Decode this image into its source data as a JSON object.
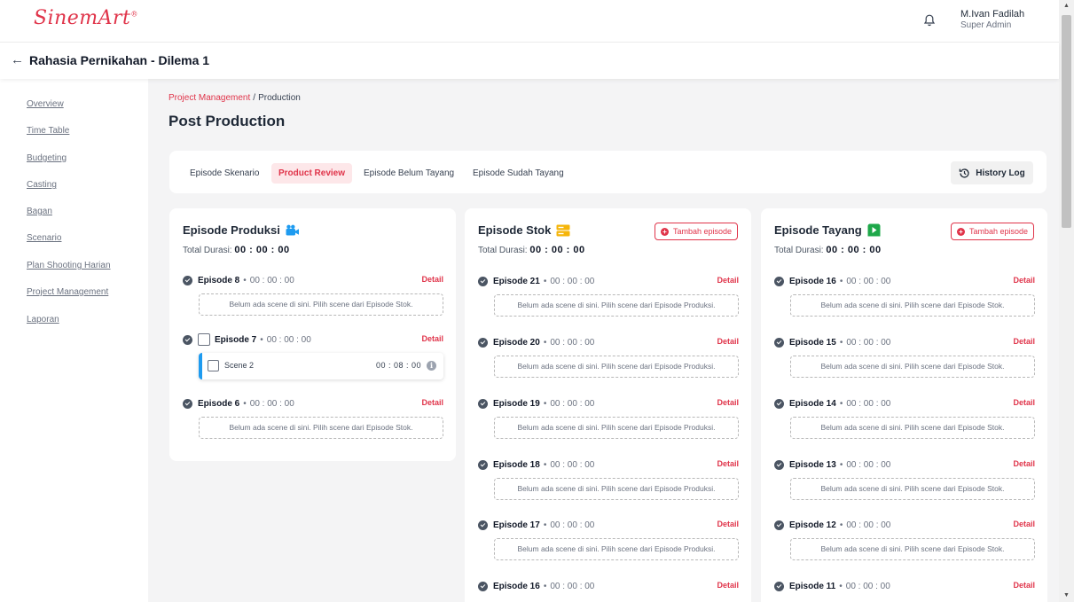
{
  "app": {
    "logo": "SinemArt",
    "logo_mark": "®"
  },
  "user": {
    "name": "M.Ivan Fadilah",
    "role": "Super Admin"
  },
  "project": {
    "back_arrow": "←",
    "title": "Rahasia Pernikahan - Dilema 1"
  },
  "sidebar": {
    "items": [
      {
        "label": "Overview"
      },
      {
        "label": "Time Table"
      },
      {
        "label": "Budgeting"
      },
      {
        "label": "Casting"
      },
      {
        "label": "Bagan"
      },
      {
        "label": "Scenario"
      },
      {
        "label": "Plan Shooting Harian"
      },
      {
        "label": "Project Management"
      },
      {
        "label": "Laporan"
      }
    ]
  },
  "breadcrumb": {
    "parent": "Project Management",
    "separator": "/",
    "current": "Production"
  },
  "page_title": "Post Production",
  "tabs": [
    {
      "label": "Episode Skenario",
      "active": false
    },
    {
      "label": "Product Review",
      "active": true
    },
    {
      "label": "Episode Belum Tayang",
      "active": false
    },
    {
      "label": "Episode Sudah Tayang",
      "active": false
    }
  ],
  "history_log": {
    "label": "History Log"
  },
  "colors": {
    "accent": "#e0344a",
    "scene_bar": "#1e9bf0",
    "stok_icon": "#f5b50a",
    "tayang_icon": "#1ea84a",
    "produksi_icon": "#1e9bf0"
  },
  "columns": {
    "produksi": {
      "title": "Episode Produksi",
      "icon": "camera-icon",
      "total_label": "Total Durasi:",
      "total_value": "00 : 00 : 00",
      "episodes": [
        {
          "name": "Episode 8",
          "time": "00 : 00 : 00",
          "detail": "Detail",
          "empty": "Belum ada scene di sini. Pilih scene dari Episode Stok."
        },
        {
          "name": "Episode 7",
          "time": "00 : 00 : 00",
          "detail": "Detail",
          "scene": {
            "label": "Scene 2",
            "time": "00 : 08 : 00"
          }
        },
        {
          "name": "Episode 6",
          "time": "00 : 00 : 00",
          "detail": "Detail",
          "empty": "Belum ada scene di sini. Pilih scene dari Episode Stok."
        }
      ]
    },
    "stok": {
      "title": "Episode Stok",
      "icon": "server-icon",
      "add_label": "Tambah episode",
      "total_label": "Total Durasi:",
      "total_value": "00 : 00 : 00",
      "episodes": [
        {
          "name": "Episode 21",
          "time": "00 : 00 : 00",
          "detail": "Detail",
          "empty": "Belum ada scene di sini. Pilih scene dari Episode Produksi."
        },
        {
          "name": "Episode 20",
          "time": "00 : 00 : 00",
          "detail": "Detail",
          "empty": "Belum ada scene di sini. Pilih scene dari Episode Produksi."
        },
        {
          "name": "Episode 19",
          "time": "00 : 00 : 00",
          "detail": "Detail",
          "empty": "Belum ada scene di sini. Pilih scene dari Episode Produksi."
        },
        {
          "name": "Episode 18",
          "time": "00 : 00 : 00",
          "detail": "Detail",
          "empty": "Belum ada scene di sini. Pilih scene dari Episode Produksi."
        },
        {
          "name": "Episode 17",
          "time": "00 : 00 : 00",
          "detail": "Detail",
          "empty": "Belum ada scene di sini. Pilih scene dari Episode Produksi."
        },
        {
          "name": "Episode 16",
          "time": "00 : 00 : 00",
          "detail": "Detail"
        }
      ]
    },
    "tayang": {
      "title": "Episode Tayang",
      "icon": "play-icon",
      "add_label": "Tambah episode",
      "total_label": "Total Durasi:",
      "total_value": "00 : 00 : 00",
      "episodes": [
        {
          "name": "Episode 16",
          "time": "00 : 00 : 00",
          "detail": "Detail",
          "empty": "Belum ada scene di sini. Pilih scene dari Episode Stok."
        },
        {
          "name": "Episode 15",
          "time": "00 : 00 : 00",
          "detail": "Detail",
          "empty": "Belum ada scene di sini. Pilih scene dari Episode Stok."
        },
        {
          "name": "Episode 14",
          "time": "00 : 00 : 00",
          "detail": "Detail",
          "empty": "Belum ada scene di sini. Pilih scene dari Episode Stok."
        },
        {
          "name": "Episode 13",
          "time": "00 : 00 : 00",
          "detail": "Detail",
          "empty": "Belum ada scene di sini. Pilih scene dari Episode Stok."
        },
        {
          "name": "Episode 12",
          "time": "00 : 00 : 00",
          "detail": "Detail",
          "empty": "Belum ada scene di sini. Pilih scene dari Episode Stok."
        },
        {
          "name": "Episode 11",
          "time": "00 : 00 : 00",
          "detail": "Detail"
        }
      ]
    }
  }
}
